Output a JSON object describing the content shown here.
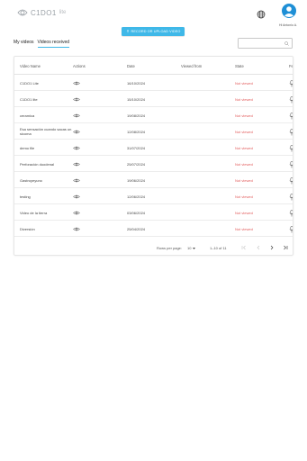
{
  "header": {
    "logo_text": "C1DO1",
    "logo_suffix": "lite",
    "user_name": "Hi Antonio A.",
    "icons": {
      "language": "globe-icon",
      "avatar": "user-avatar-icon"
    }
  },
  "toolbar": {
    "record_button_label": "RECORD OR UPLOAD VIDEO"
  },
  "tabs": [
    {
      "label": "My videos",
      "active": false
    },
    {
      "label": "Videos received",
      "active": true
    }
  ],
  "search": {
    "placeholder": ""
  },
  "table": {
    "columns": [
      "Video Name",
      "Actions",
      "Date",
      "Viewed from",
      "State",
      "Fe"
    ],
    "rows": [
      {
        "name": "C1DO1 Lite",
        "date": "16/10/2024",
        "viewed_from": "",
        "state": "Not viewed"
      },
      {
        "name": "C1DO1 lite",
        "date": "15/10/2024",
        "viewed_from": "",
        "state": "Not viewed"
      },
      {
        "name": "ceramica",
        "date": "19/08/2024",
        "viewed_from": "",
        "state": "Not viewed"
      },
      {
        "name": "Esa sensación cuando sacas un sicoma",
        "date": "12/08/2024",
        "viewed_from": "",
        "state": "Not viewed"
      },
      {
        "name": "demo file",
        "date": "31/07/2024",
        "viewed_from": "",
        "state": "Not viewed"
      },
      {
        "name": "Perforación duodenal",
        "date": "25/07/2024",
        "viewed_from": "",
        "state": "Not viewed"
      },
      {
        "name": "Gastroyeyuno",
        "date": "19/06/2024",
        "viewed_from": "",
        "state": "Not viewed"
      },
      {
        "name": "testing",
        "date": "12/06/2024",
        "viewed_from": "",
        "state": "Not viewed"
      },
      {
        "name": "Video de la tierra",
        "date": "03/06/2024",
        "viewed_from": "",
        "state": "Not viewed"
      },
      {
        "name": "Diversión",
        "date": "25/04/2024",
        "viewed_from": "",
        "state": "Not viewed"
      }
    ],
    "row_icons": {
      "action": "eye-icon",
      "feedback": "microphone-icon"
    }
  },
  "pagination": {
    "rows_per_page_label": "Rows per page:",
    "rows_per_page_value": "10",
    "range_label": "1–10 of 11"
  },
  "colors": {
    "accent": "#3fb8e8",
    "not_viewed": "#e25c5c",
    "avatar": "#1e8fd6"
  }
}
